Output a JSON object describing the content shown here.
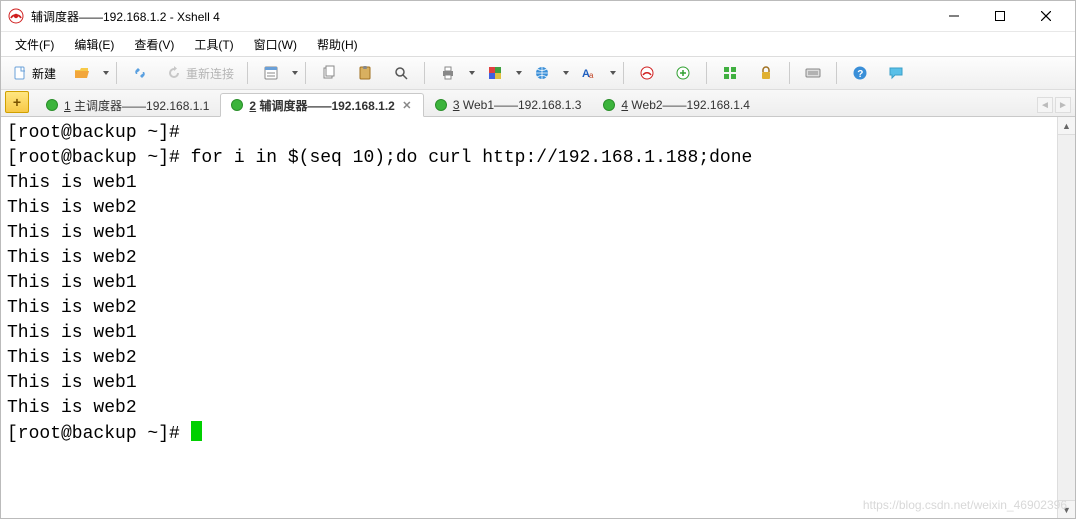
{
  "window": {
    "title": "辅调度器——192.168.1.2 - Xshell 4"
  },
  "menu": {
    "file": "文件(F)",
    "edit": "编辑(E)",
    "view": "查看(V)",
    "tools": "工具(T)",
    "window": "窗口(W)",
    "help": "帮助(H)"
  },
  "toolbar": {
    "new_label": "新建",
    "reconnect_label": "重新连接"
  },
  "tabs": {
    "add": "+",
    "items": [
      {
        "num": "1",
        "label": " 主调度器——192.168.1.1",
        "active": false
      },
      {
        "num": "2",
        "label": " 辅调度器——192.168.1.2",
        "active": true
      },
      {
        "num": "3",
        "label": " Web1——192.168.1.3",
        "active": false
      },
      {
        "num": "4",
        "label": " Web2——192.168.1.4",
        "active": false
      }
    ]
  },
  "terminal": {
    "lines": [
      "[root@backup ~]# ",
      "[root@backup ~]# for i in $(seq 10);do curl http://192.168.1.188;done",
      "This is web1",
      "This is web2",
      "This is web1",
      "This is web2",
      "This is web1",
      "This is web2",
      "This is web1",
      "This is web2",
      "This is web1",
      "This is web2"
    ],
    "prompt": "[root@backup ~]# "
  },
  "watermark": "https://blog.csdn.net/weixin_46902396"
}
